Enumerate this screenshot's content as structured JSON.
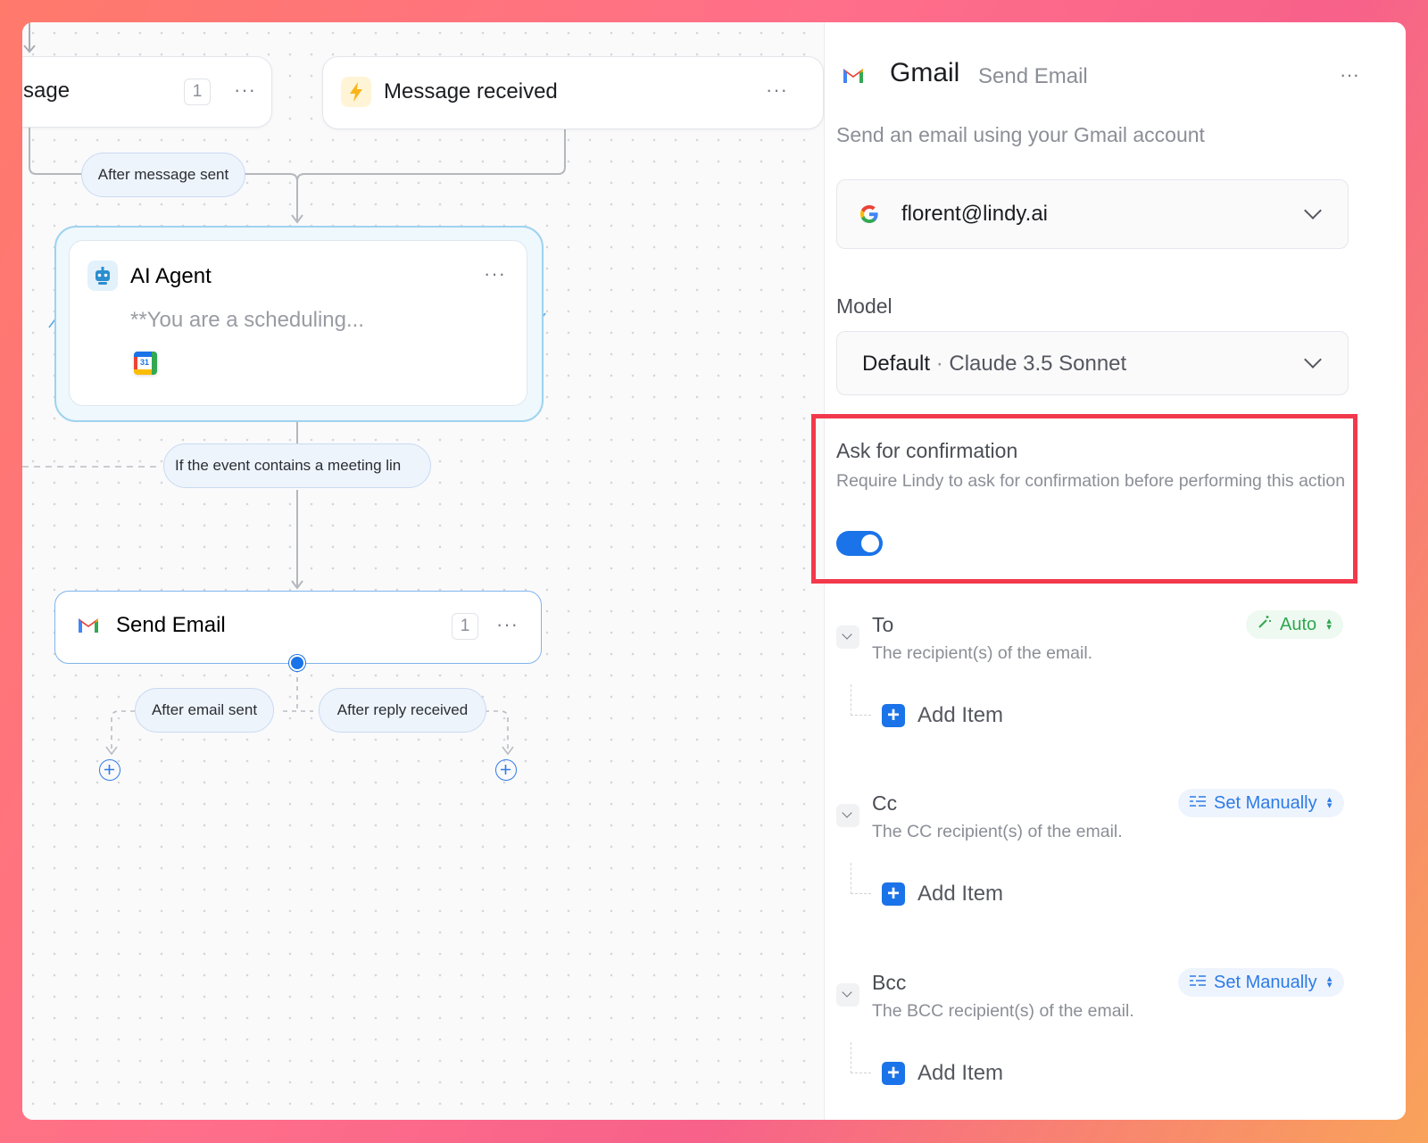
{
  "canvas": {
    "partial_node": {
      "title": "sage",
      "count": "1",
      "menu": "···"
    },
    "trigger_node": {
      "title": "Message received",
      "menu": "···"
    },
    "edge_after_message_sent": "After message sent",
    "agent_node": {
      "title": "AI Agent",
      "prompt_preview": "**You are a scheduling...",
      "menu": "···",
      "tool_icon": "google-calendar-icon",
      "calendar_day": "31"
    },
    "edge_condition": "If the event contains a meeting lin",
    "send_email_node": {
      "title": "Send Email",
      "count": "1",
      "menu": "···"
    },
    "edge_after_email_sent": "After email sent",
    "edge_after_reply_received": "After reply received"
  },
  "panel": {
    "app_name": "Gmail",
    "action_name": "Send Email",
    "menu": "···",
    "description": "Send an email using your Gmail account",
    "account": {
      "value": "florent@lindy.ai",
      "icon": "google-icon"
    },
    "model": {
      "label": "Model",
      "value_bold": "Default",
      "separator": " · ",
      "value_rest": "Claude 3.5 Sonnet"
    },
    "confirmation": {
      "title": "Ask for confirmation",
      "description": "Require Lindy to ask for confirmation before performing this action",
      "enabled": true
    },
    "fields": [
      {
        "label": "To",
        "description": "The recipient(s) of the email.",
        "mode": "Auto",
        "add_label": "Add Item"
      },
      {
        "label": "Cc",
        "description": "The CC recipient(s) of the email.",
        "mode": "Set Manually",
        "add_label": "Add Item"
      },
      {
        "label": "Bcc",
        "description": "The BCC recipient(s) of the email.",
        "mode": "Set Manually",
        "add_label": "Add Item"
      }
    ]
  },
  "colors": {
    "accent_blue": "#1a73e8",
    "highlight_red": "#f2394b",
    "auto_green": "#2fa64f",
    "trigger_yellow": "#f9b51c"
  }
}
